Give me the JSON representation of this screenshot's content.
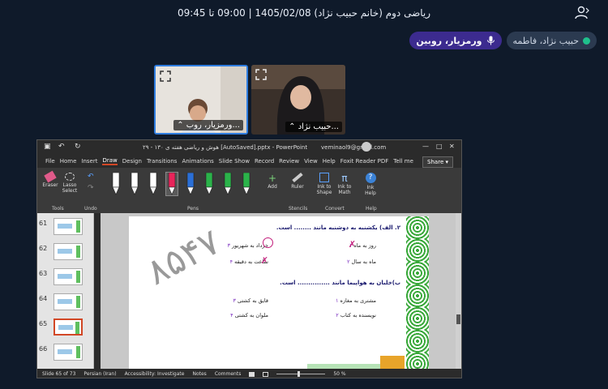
{
  "header": {
    "session_title": "ریاضی دوم (خانم حبیب نژاد) 1405/02/08 | 09:00 تا 09:45",
    "user_icon": "user-icon"
  },
  "participants": [
    {
      "name": "حبیب نژاد، فاطمه",
      "status_color": "#1fc08c"
    },
    {
      "name": "ورمزیار، روبین",
      "speaking": true
    }
  ],
  "videos": [
    {
      "label": "ورمزیار، روب..."
    },
    {
      "label": "حبیب نژاد..."
    }
  ],
  "powerpoint": {
    "doc_title": "هوش و ریاضی هفته ی ۱۳۰ - ۲۹ [AutoSaved].pptx  -  PowerPoint",
    "account": "veminaol9@gmail.com",
    "tabs": [
      "File",
      "Home",
      "Insert",
      "Draw",
      "Design",
      "Transitions",
      "Animations",
      "Slide Show",
      "Record",
      "Review",
      "View",
      "Help",
      "Foxit Reader PDF",
      "Tell me"
    ],
    "active_tab": "Draw",
    "share_label": "Share",
    "ribbon": {
      "tools": {
        "eraser": "Eraser",
        "lasso": "Lasso Select",
        "group": "Tools"
      },
      "undo_group": "Undo",
      "pens_group": "Pens",
      "add_label": "Add",
      "ruler": "Ruler",
      "stencils_group": "Stencils",
      "ink_to_shape": "Ink to Shape",
      "ink_to_math": "Ink to Math",
      "convert_group": "Convert",
      "ink_help": "Ink Help",
      "help_group": "Help"
    },
    "pen_colors": [
      "#ffffff",
      "#ffffff",
      "#ffffff",
      "#e8245a",
      "#2b6fd6",
      "#2bb34a",
      "#2bb34a",
      "#2bb34a"
    ],
    "slide_numbers": [
      "61",
      "62",
      "63",
      "64",
      "65",
      "66"
    ],
    "selected_slide": "65",
    "slide": {
      "handwritten": "۸۵۴۷",
      "q1": "۲. الف) یکشنبه به دوشنبه مانند ........ است.",
      "q1_opts": [
        "روز به ماه",
        "ماه به سال",
        "خرداد به شهریور",
        "ساعت به دقیقه"
      ],
      "q1_markers": [
        "۱",
        "۲",
        "۳",
        "۴"
      ],
      "q2": "ب)خلبان به هواپیما مانند ............... است.",
      "q2_opts": [
        "مشتری به مغازه",
        "نویسنده به کتاب",
        "قایق به کشتی",
        "ملوان به کشتی"
      ],
      "q2_markers": [
        "۱",
        "۲",
        "۳",
        "۴"
      ]
    },
    "status": {
      "slide_info": "Slide 65 of 73",
      "language": "Persian (Iran)",
      "accessibility": "Accessibility: Investigate",
      "notes": "Notes",
      "comments": "Comments",
      "zoom": "50 %"
    }
  }
}
